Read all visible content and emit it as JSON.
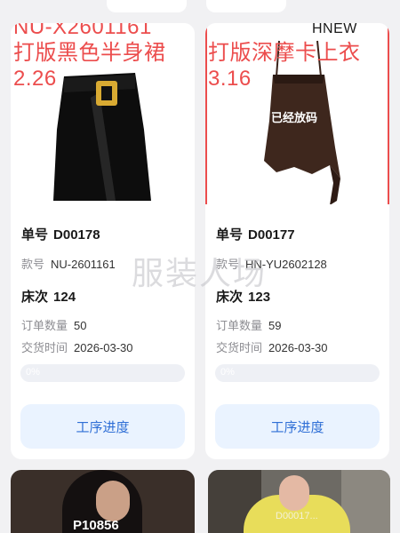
{
  "watermark": "服装人场",
  "colors": {
    "overlay_red": "#ec4d4d",
    "button_bg": "#eaf3ff",
    "button_text": "#2f6fd6",
    "progress_track": "#eef0f5"
  },
  "cards": [
    {
      "photo": {
        "overlay_top": "NU-X2601161",
        "overlay_line2": "打版黑色半身裙",
        "overlay_line3": "2.26",
        "stamp": ""
      },
      "order_label": "单号",
      "order_no": "D00178",
      "style_label": "款号",
      "style_no": "NU-2601161",
      "bed_label": "床次",
      "bed_no": "124",
      "qty_label": "订单数量",
      "qty": "50",
      "date_label": "交货时间",
      "date": "2026-03-30",
      "progress": 0,
      "progress_text": "0%",
      "button_label": "工序进度"
    },
    {
      "photo": {
        "overlay_top": "HNEW",
        "overlay_line2": "打版深摩卡上衣",
        "overlay_line3": "3.16",
        "stamp": "已经放码"
      },
      "order_label": "单号",
      "order_no": "D00177",
      "style_label": "款号",
      "style_no": "HN-YU2602128",
      "bed_label": "床次",
      "bed_no": "123",
      "qty_label": "订单数量",
      "qty": "59",
      "date_label": "交货时间",
      "date": "2026-03-30",
      "progress": 0,
      "progress_text": "0%",
      "button_label": "工序进度"
    }
  ],
  "bottom_cards": [
    {
      "label": "P10856"
    },
    {
      "label": "D00017..."
    }
  ]
}
